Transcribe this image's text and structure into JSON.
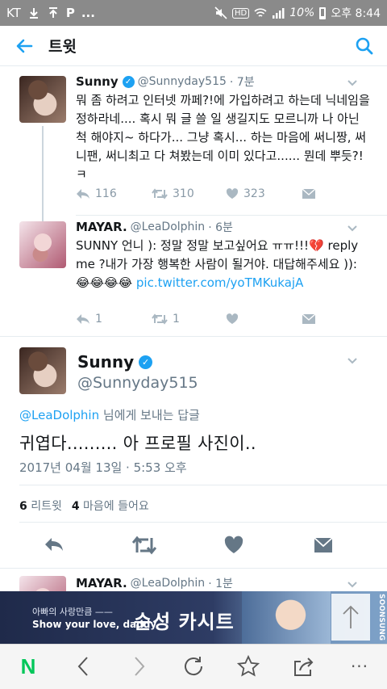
{
  "status_bar": {
    "carrier": "KT",
    "p_badge": "P",
    "more": "...",
    "hd": "HD",
    "battery": "10%",
    "time": "오후 8:44"
  },
  "header": {
    "title": "트윗"
  },
  "tweets": [
    {
      "name": "Sunny",
      "handle": "@Sunnyday515",
      "time": "· 7분",
      "text": "뭐 좀 하려고 인터넷 까페?!에 가입하려고 하는데 닉네임을 정하라네.... 혹시 뭐 글 쓸 일 생길지도 모르니까 나 아닌 척 해야지~ 하다가... 그냥 혹시... 하는 마음에 써니짱, 써니팬, 써니최고 다 쳐봤는데 이미 있다고...... 뭔데 뿌듯?!ㅋ",
      "replies": "116",
      "retweets": "310",
      "likes": "323"
    },
    {
      "name": "MAYAR.",
      "handle": "@LeaDolphin",
      "time": "· 6분",
      "text_main": "SUNNY 언니 ): 정말 정말 보고싶어요 ㅠㅠ!!!💔 reply me ?내가 가장 행복한 사람이 될거야. 대답해주세요 )):😂😂😂😂 ",
      "link": "pic.twitter.com/yoTMKukajA",
      "replies": "1",
      "retweets": "1"
    }
  ],
  "main_tweet": {
    "name": "Sunny",
    "handle": "@Sunnyday515",
    "reply_handle": "@LeaDolphin",
    "reply_suffix": " 님에게 보내는 답글",
    "text": "귀엽다......... 아 프로필 사진이..",
    "date": "2017년 04월 13일 · 5:53 오후",
    "retweet_count": "6",
    "retweet_label": "리트윗",
    "like_count": "4",
    "like_label": "마음에 들어요"
  },
  "next_tweet": {
    "name": "MAYAR.",
    "handle": "@LeaDolphin",
    "time": "· 1분"
  },
  "ad": {
    "line1": "아빠의 사랑만큼 ——",
    "line2": "Show your love, daddy",
    "headline": "순성 카시트",
    "brand": "SOONSUNG"
  },
  "bottom_nav": {
    "logo": "N",
    "menu": "···"
  },
  "colors": {
    "accent": "#1da1f2",
    "status_bar": "#8a8a8a",
    "naver_green": "#03c75a",
    "text_secondary": "#657786"
  },
  "icons": [
    "back-arrow-icon",
    "search-icon",
    "verified-icon",
    "chevron-down-icon",
    "reply-icon",
    "retweet-icon",
    "like-heart-icon",
    "dm-envelope-icon",
    "scroll-top-icon",
    "refresh-icon",
    "star-icon",
    "share-icon"
  ]
}
